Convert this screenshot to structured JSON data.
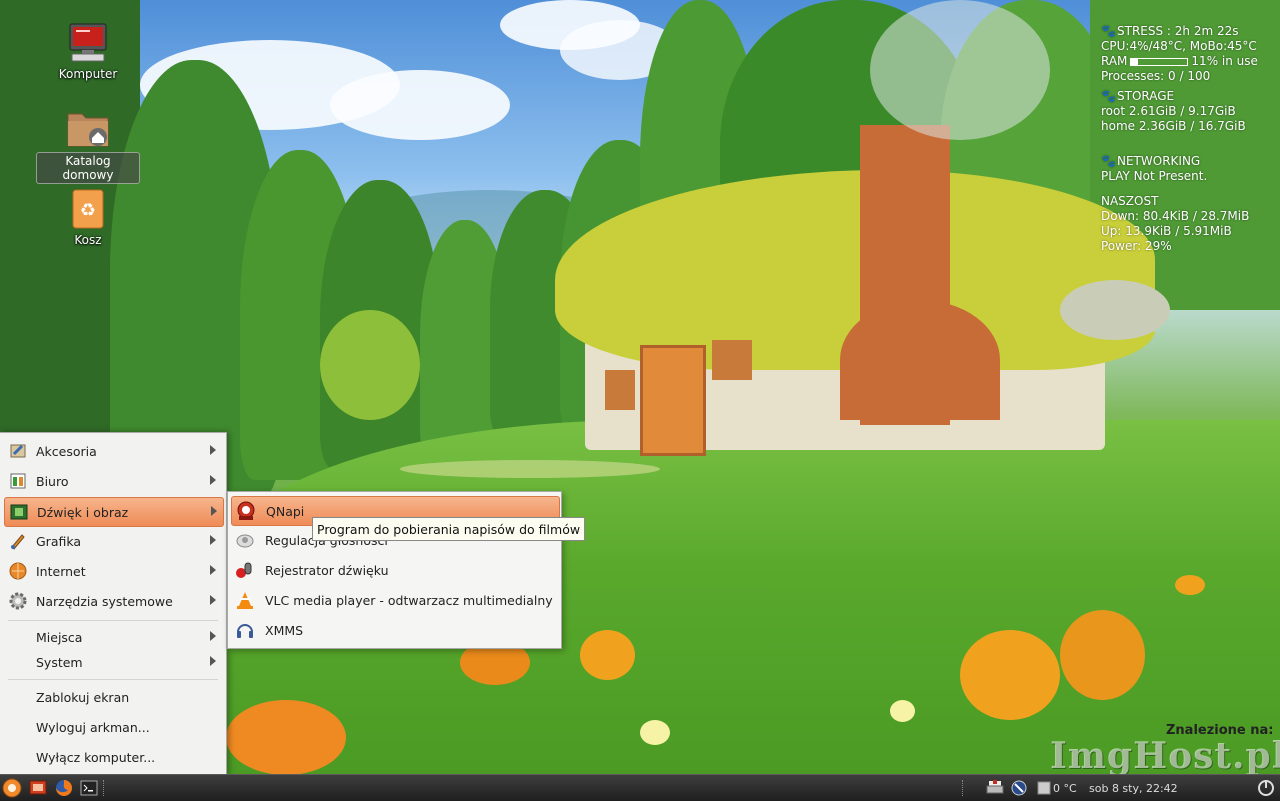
{
  "desktop": {
    "icons": [
      {
        "label": "Komputer"
      },
      {
        "label": "Katalog domowy"
      },
      {
        "label": "Kosz"
      }
    ]
  },
  "conky": {
    "stress": "STRESS : 2h 2m 22s",
    "cpu": "CPU:4%/48°C, MoBo:45°C",
    "ram_label": "RAM",
    "ram_value": "11% in use",
    "ram_fraction": 0.11,
    "processes": "Processes: 0 / 100",
    "storage": "STORAGE",
    "root": "root 2.61GiB / 9.17GiB",
    "home": "home 2.36GiB / 16.7GiB",
    "networking": "NETWORKING",
    "play": "PLAY Not Present.",
    "naszost": "NASZOST",
    "down": "Down: 80.4KiB / 28.7MiB",
    "up": "Up: 13.9KiB / 5.91MiB",
    "power": "Power: 29%"
  },
  "menu": {
    "items": [
      {
        "label": "Akcesoria"
      },
      {
        "label": "Biuro"
      },
      {
        "label": "Dźwięk i obraz"
      },
      {
        "label": "Grafika"
      },
      {
        "label": "Internet"
      },
      {
        "label": "Narzędzia systemowe"
      },
      {
        "label": "Miejsca"
      },
      {
        "label": "System"
      },
      {
        "label": "Zablokuj ekran"
      },
      {
        "label": "Wyloguj arkman..."
      },
      {
        "label": "Wyłącz komputer..."
      }
    ],
    "active": "Dźwięk i obraz"
  },
  "submenu": {
    "items": [
      {
        "label": "QNapi"
      },
      {
        "label": "Regulacja głośności"
      },
      {
        "label": "Rejestrator dźwięku"
      },
      {
        "label": "VLC media player - odtwarzacz multimedialny"
      },
      {
        "label": "XMMS"
      }
    ],
    "tooltip": "Program do pobierania napisów do filmów"
  },
  "taskbar": {
    "temperature": "0 °C",
    "clock": "sob  8 sty, 22:42"
  },
  "overlay": {
    "found": "Znalezione na:",
    "watermark": "ImgHost.pl"
  },
  "colors": {
    "highlight": "#ef8b57",
    "menu_bg": "#f2f2f1",
    "taskbar": "#2b2b2b"
  }
}
